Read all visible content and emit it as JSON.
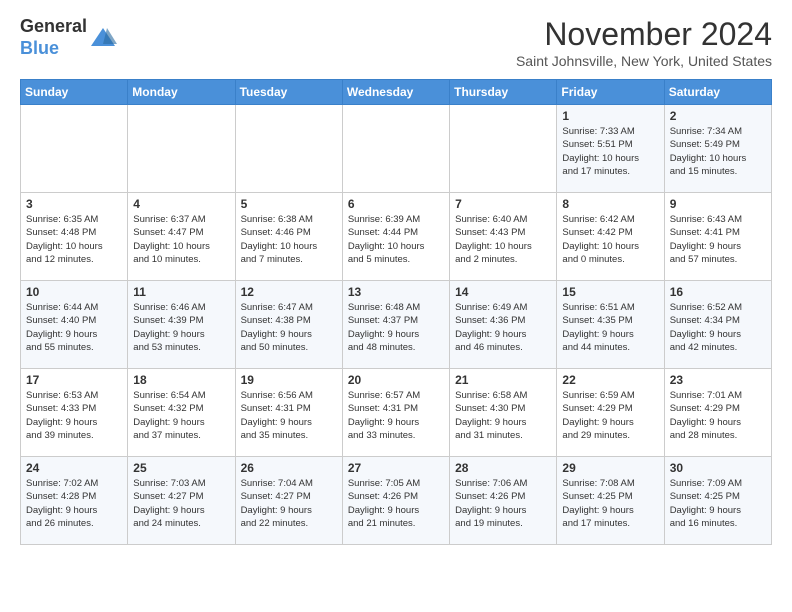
{
  "header": {
    "logo_general": "General",
    "logo_blue": "Blue",
    "month_title": "November 2024",
    "location": "Saint Johnsville, New York, United States"
  },
  "weekdays": [
    "Sunday",
    "Monday",
    "Tuesday",
    "Wednesday",
    "Thursday",
    "Friday",
    "Saturday"
  ],
  "weeks": [
    [
      {
        "day": "",
        "info": ""
      },
      {
        "day": "",
        "info": ""
      },
      {
        "day": "",
        "info": ""
      },
      {
        "day": "",
        "info": ""
      },
      {
        "day": "",
        "info": ""
      },
      {
        "day": "1",
        "info": "Sunrise: 7:33 AM\nSunset: 5:51 PM\nDaylight: 10 hours\nand 17 minutes."
      },
      {
        "day": "2",
        "info": "Sunrise: 7:34 AM\nSunset: 5:49 PM\nDaylight: 10 hours\nand 15 minutes."
      }
    ],
    [
      {
        "day": "3",
        "info": "Sunrise: 6:35 AM\nSunset: 4:48 PM\nDaylight: 10 hours\nand 12 minutes."
      },
      {
        "day": "4",
        "info": "Sunrise: 6:37 AM\nSunset: 4:47 PM\nDaylight: 10 hours\nand 10 minutes."
      },
      {
        "day": "5",
        "info": "Sunrise: 6:38 AM\nSunset: 4:46 PM\nDaylight: 10 hours\nand 7 minutes."
      },
      {
        "day": "6",
        "info": "Sunrise: 6:39 AM\nSunset: 4:44 PM\nDaylight: 10 hours\nand 5 minutes."
      },
      {
        "day": "7",
        "info": "Sunrise: 6:40 AM\nSunset: 4:43 PM\nDaylight: 10 hours\nand 2 minutes."
      },
      {
        "day": "8",
        "info": "Sunrise: 6:42 AM\nSunset: 4:42 PM\nDaylight: 10 hours\nand 0 minutes."
      },
      {
        "day": "9",
        "info": "Sunrise: 6:43 AM\nSunset: 4:41 PM\nDaylight: 9 hours\nand 57 minutes."
      }
    ],
    [
      {
        "day": "10",
        "info": "Sunrise: 6:44 AM\nSunset: 4:40 PM\nDaylight: 9 hours\nand 55 minutes."
      },
      {
        "day": "11",
        "info": "Sunrise: 6:46 AM\nSunset: 4:39 PM\nDaylight: 9 hours\nand 53 minutes."
      },
      {
        "day": "12",
        "info": "Sunrise: 6:47 AM\nSunset: 4:38 PM\nDaylight: 9 hours\nand 50 minutes."
      },
      {
        "day": "13",
        "info": "Sunrise: 6:48 AM\nSunset: 4:37 PM\nDaylight: 9 hours\nand 48 minutes."
      },
      {
        "day": "14",
        "info": "Sunrise: 6:49 AM\nSunset: 4:36 PM\nDaylight: 9 hours\nand 46 minutes."
      },
      {
        "day": "15",
        "info": "Sunrise: 6:51 AM\nSunset: 4:35 PM\nDaylight: 9 hours\nand 44 minutes."
      },
      {
        "day": "16",
        "info": "Sunrise: 6:52 AM\nSunset: 4:34 PM\nDaylight: 9 hours\nand 42 minutes."
      }
    ],
    [
      {
        "day": "17",
        "info": "Sunrise: 6:53 AM\nSunset: 4:33 PM\nDaylight: 9 hours\nand 39 minutes."
      },
      {
        "day": "18",
        "info": "Sunrise: 6:54 AM\nSunset: 4:32 PM\nDaylight: 9 hours\nand 37 minutes."
      },
      {
        "day": "19",
        "info": "Sunrise: 6:56 AM\nSunset: 4:31 PM\nDaylight: 9 hours\nand 35 minutes."
      },
      {
        "day": "20",
        "info": "Sunrise: 6:57 AM\nSunset: 4:31 PM\nDaylight: 9 hours\nand 33 minutes."
      },
      {
        "day": "21",
        "info": "Sunrise: 6:58 AM\nSunset: 4:30 PM\nDaylight: 9 hours\nand 31 minutes."
      },
      {
        "day": "22",
        "info": "Sunrise: 6:59 AM\nSunset: 4:29 PM\nDaylight: 9 hours\nand 29 minutes."
      },
      {
        "day": "23",
        "info": "Sunrise: 7:01 AM\nSunset: 4:29 PM\nDaylight: 9 hours\nand 28 minutes."
      }
    ],
    [
      {
        "day": "24",
        "info": "Sunrise: 7:02 AM\nSunset: 4:28 PM\nDaylight: 9 hours\nand 26 minutes."
      },
      {
        "day": "25",
        "info": "Sunrise: 7:03 AM\nSunset: 4:27 PM\nDaylight: 9 hours\nand 24 minutes."
      },
      {
        "day": "26",
        "info": "Sunrise: 7:04 AM\nSunset: 4:27 PM\nDaylight: 9 hours\nand 22 minutes."
      },
      {
        "day": "27",
        "info": "Sunrise: 7:05 AM\nSunset: 4:26 PM\nDaylight: 9 hours\nand 21 minutes."
      },
      {
        "day": "28",
        "info": "Sunrise: 7:06 AM\nSunset: 4:26 PM\nDaylight: 9 hours\nand 19 minutes."
      },
      {
        "day": "29",
        "info": "Sunrise: 7:08 AM\nSunset: 4:25 PM\nDaylight: 9 hours\nand 17 minutes."
      },
      {
        "day": "30",
        "info": "Sunrise: 7:09 AM\nSunset: 4:25 PM\nDaylight: 9 hours\nand 16 minutes."
      }
    ]
  ]
}
